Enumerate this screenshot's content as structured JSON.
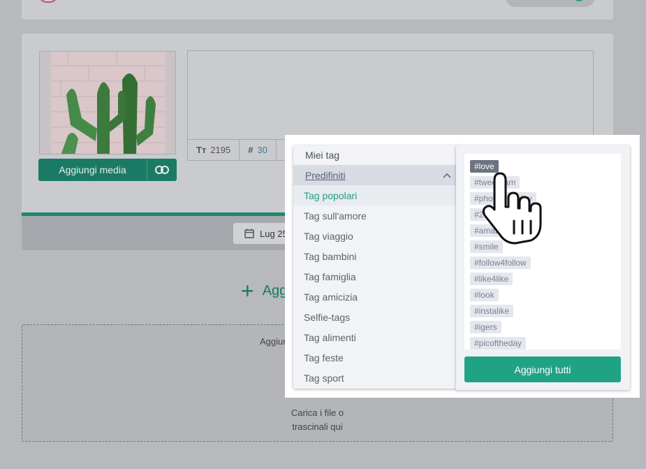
{
  "composer": {
    "media_button": "Aggiungi media",
    "char_count": "2195",
    "hashtag_count": "30",
    "date": "Lug 25"
  },
  "add_post": {
    "label": "Aggi"
  },
  "dropzone": {
    "title": "Aggiung",
    "line1": "Carica i file o",
    "line2": "trascinali qui"
  },
  "menu": {
    "my_tags": "Miei tag",
    "section": "Predifiniti",
    "items": [
      "Tag popolari",
      "Tag sull'amore",
      "Tag viaggio",
      "Tag bambini",
      "Tag famiglia",
      "Tag amicizia",
      "Selfie-tags",
      "Tag alimenti",
      "Tag feste",
      "Tag sport"
    ]
  },
  "tags": [
    "#love",
    "#tweegram",
    "#photooftheday",
    "#20likes",
    "#amazing",
    "#smile",
    "#follow4follow",
    "#like4like",
    "#look",
    "#instalike",
    "#igers",
    "#picoftheday"
  ],
  "add_all_button": "Aggiungi tutti",
  "colors": {
    "accent": "#20a384",
    "accent_dark": "#1b7a64",
    "selected_tag": "#6b7480"
  },
  "icons": {
    "text_size": "text-size-icon",
    "hashtag": "hashtag-icon",
    "link": "link-icon",
    "calendar": "calendar-icon",
    "chevron": "chevron-up-icon",
    "cursor": "hand-pointer-icon"
  }
}
